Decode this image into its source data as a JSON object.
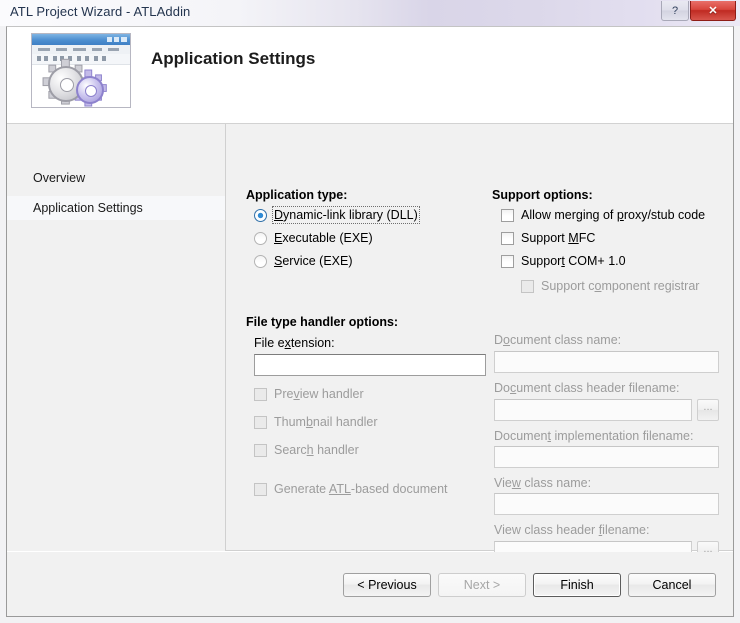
{
  "window": {
    "title": "ATL Project Wizard - ATLAddin",
    "help_button": "?",
    "close_button": "✕"
  },
  "banner": {
    "heading": "Application Settings",
    "icon": "application-settings-gears-icon"
  },
  "sidebar": {
    "items": [
      {
        "label": "Overview",
        "selected": false
      },
      {
        "label": "Application Settings",
        "selected": true
      }
    ]
  },
  "application_type": {
    "title": "Application type:",
    "options": [
      {
        "pre": "",
        "accel": "D",
        "post": "ynamic-link library (DLL)",
        "checked": true,
        "focused": true
      },
      {
        "pre": "",
        "accel": "E",
        "post": "xecutable (EXE)",
        "checked": false,
        "focused": false
      },
      {
        "pre": "",
        "accel": "S",
        "post": "ervice (EXE)",
        "checked": false,
        "focused": false
      }
    ]
  },
  "support_options": {
    "title": "Support options:",
    "options": [
      {
        "pre": "Allow merging of ",
        "accel": "p",
        "post": "roxy/stub code",
        "checked": false,
        "enabled": true,
        "indented": false
      },
      {
        "pre": "Support ",
        "accel": "M",
        "post": "FC",
        "checked": false,
        "enabled": true,
        "indented": false
      },
      {
        "pre": "Suppor",
        "accel": "t",
        "post": " COM+ 1.0",
        "checked": false,
        "enabled": true,
        "indented": false
      },
      {
        "pre": "Support c",
        "accel": "o",
        "post": "mponent registrar",
        "checked": false,
        "enabled": false,
        "indented": true
      }
    ]
  },
  "file_type_handler": {
    "title": "File type handler options:",
    "extension_label": {
      "pre": "File e",
      "accel": "x",
      "post": "tension:"
    },
    "extension_value": "",
    "extension_placeholder": "",
    "options": [
      {
        "pre": "Pre",
        "accel": "v",
        "post": "iew handler",
        "checked": false,
        "enabled": false
      },
      {
        "pre": "Thum",
        "accel": "b",
        "post": "nail handler",
        "checked": false,
        "enabled": false
      },
      {
        "pre": "Searc",
        "accel": "h",
        "post": " handler",
        "checked": false,
        "enabled": false
      },
      {
        "pre": "Generate ",
        "accel": "ATL",
        "post": "-based document",
        "checked": false,
        "enabled": false
      }
    ]
  },
  "document_fields": [
    {
      "label": {
        "pre": "D",
        "accel": "o",
        "post": "cument class name:"
      },
      "value": "",
      "enabled": false,
      "browse": false
    },
    {
      "label": {
        "pre": "Do",
        "accel": "c",
        "post": "ument class header filename:"
      },
      "value": "",
      "enabled": false,
      "browse": true
    },
    {
      "label": {
        "pre": "Documen",
        "accel": "t",
        "post": " implementation filename:"
      },
      "value": "",
      "enabled": false,
      "browse": false
    },
    {
      "label": {
        "pre": "Vie",
        "accel": "w",
        "post": " class name:"
      },
      "value": "",
      "enabled": false,
      "browse": false
    },
    {
      "label": {
        "pre": "View class header ",
        "accel": "f",
        "post": "ilename:"
      },
      "value": "",
      "enabled": false,
      "browse": true
    }
  ],
  "browse_button_label": "...",
  "footer": {
    "buttons": [
      {
        "label": "< Previous",
        "enabled": true,
        "default": false
      },
      {
        "label": "Next >",
        "enabled": false,
        "default": false
      },
      {
        "label": "Finish",
        "enabled": true,
        "default": true
      },
      {
        "label": "Cancel",
        "enabled": true,
        "default": false
      }
    ]
  },
  "colors": {
    "accent_blue": "#2f8ad4",
    "close_red": "#d8453c",
    "panel_gray": "#f1f1f1",
    "title_text": "#24354f",
    "disabled_text": "#9c9c9c"
  }
}
